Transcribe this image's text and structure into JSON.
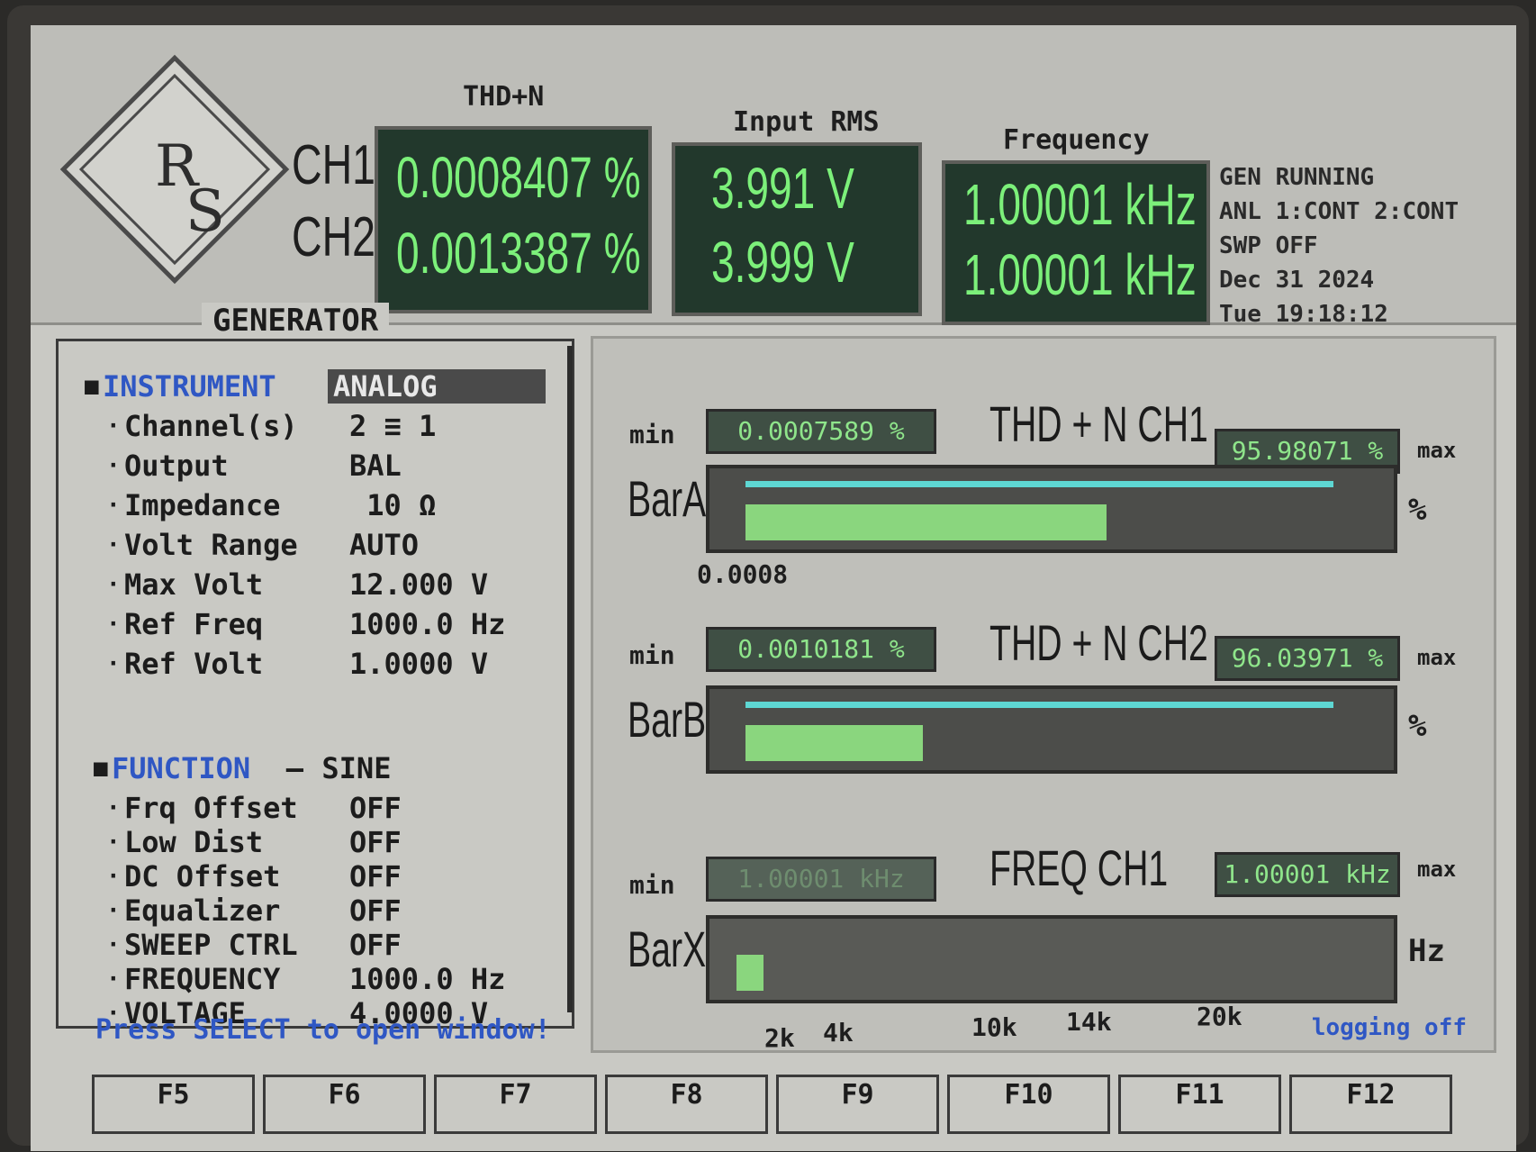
{
  "header": {
    "thd_title": "THD+N",
    "rms_title": "Input RMS",
    "freq_title": "Frequency",
    "ch1_label": "CH1",
    "ch2_label": "CH2",
    "thd_ch1": "0.0008407 %",
    "thd_ch2": "0.0013387 %",
    "rms_ch1": "3.991  V",
    "rms_ch2": "3.999  V",
    "freq_ch1": "1.00001 kHz",
    "freq_ch2": "1.00001 kHz",
    "status": [
      "GEN RUNNING",
      "ANL 1:CONT 2:CONT",
      "SWP OFF",
      "Dec 31 2024",
      "Tue 19:18:12"
    ]
  },
  "generator": {
    "title": "GENERATOR",
    "instrument": {
      "key": "INSTRUMENT",
      "value": "ANALOG"
    },
    "rows": [
      {
        "key": "Channel(s)",
        "value": "2 ≡ 1"
      },
      {
        "key": "Output",
        "value": "BAL"
      },
      {
        "key": "Impedance",
        "value": " 10 Ω"
      },
      {
        "key": "Volt Range",
        "value": "AUTO"
      },
      {
        "key": "Max Volt",
        "value": "12.000 V"
      },
      {
        "key": "Ref Freq",
        "value": "1000.0 Hz"
      },
      {
        "key": "Ref Volt",
        "value": "1.0000 V"
      }
    ],
    "function": {
      "key": "FUNCTION",
      "dash": "–",
      "value": "SINE"
    },
    "function_rows": [
      {
        "key": "Frq Offset",
        "value": "OFF"
      },
      {
        "key": "Low Dist",
        "value": "OFF"
      },
      {
        "key": "DC Offset",
        "value": "OFF"
      },
      {
        "key": "Equalizer",
        "value": "OFF"
      },
      {
        "key": "SWEEP CTRL",
        "value": "OFF"
      },
      {
        "key": "FREQUENCY",
        "value": "1000.0 Hz"
      },
      {
        "key": "VOLTAGE",
        "value": "4.0000 V"
      }
    ]
  },
  "bars": {
    "min_label": "min",
    "max_label": "max",
    "bar_a": {
      "name": "BarA",
      "title": "THD + N CH1",
      "min": "0.0007589 %",
      "max": "95.98071 %",
      "unit": "%",
      "scale_label": "0.0008",
      "fill_fraction": 0.59,
      "line_fraction": 0.96
    },
    "bar_b": {
      "name": "BarB",
      "title": "THD + N CH2",
      "min": "0.0010181 %",
      "max": "96.03971 %",
      "unit": "%",
      "fill_fraction": 0.29,
      "line_fraction": 0.96
    },
    "bar_x": {
      "name": "BarX",
      "title": "FREQ CH1",
      "min": "1.00001 kHz",
      "max": "1.00001 kHz",
      "unit": "Hz",
      "fill_fraction": 0.05,
      "ticks": [
        "2k",
        "4k",
        "10k",
        "14k",
        "20k"
      ]
    },
    "logging": "logging off"
  },
  "footer": {
    "prompt": "Press SELECT to open window!",
    "keys": [
      "F5",
      "F6",
      "F7",
      "F8",
      "F9",
      "F10",
      "F11",
      "F12"
    ]
  },
  "colors": {
    "lcd_green": "#7cf07a",
    "accent_blue": "#2f57c4",
    "bar_cyan": "#5ed7d3",
    "bar_green": "#8ad67e"
  }
}
